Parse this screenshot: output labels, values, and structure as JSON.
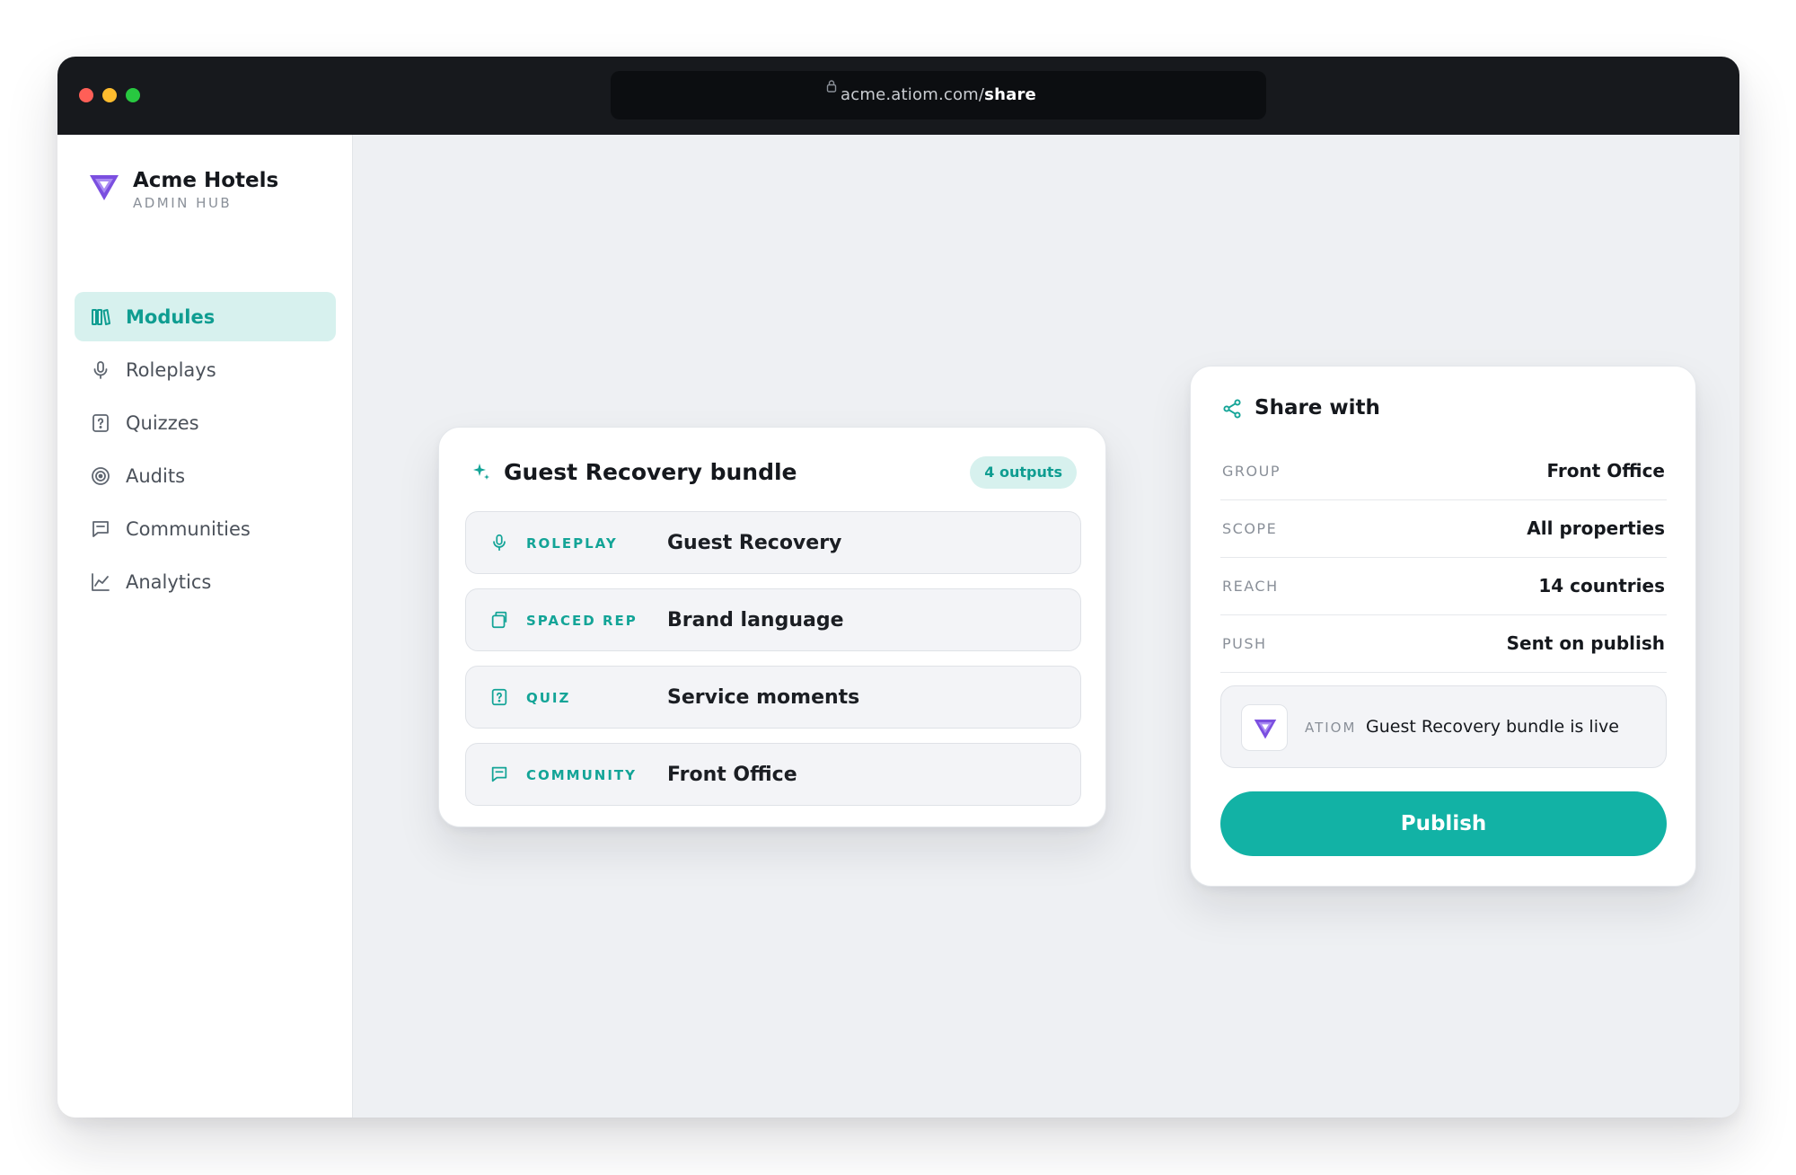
{
  "browser": {
    "url_host": "acme.atiom.com/",
    "url_path": "share"
  },
  "sidebar": {
    "brand_name": "Acme Hotels",
    "brand_sub": "ADMIN HUB",
    "items": [
      {
        "label": "Modules",
        "icon": "library-icon",
        "active": true
      },
      {
        "label": "Roleplays",
        "icon": "microphone-icon",
        "active": false
      },
      {
        "label": "Quizzes",
        "icon": "quiz-icon",
        "active": false
      },
      {
        "label": "Audits",
        "icon": "target-icon",
        "active": false
      },
      {
        "label": "Communities",
        "icon": "chat-icon",
        "active": false
      },
      {
        "label": "Analytics",
        "icon": "chart-icon",
        "active": false
      }
    ]
  },
  "bundle": {
    "title": "Guest Recovery bundle",
    "badge": "4 outputs",
    "outputs": [
      {
        "kind": "ROLEPLAY",
        "title": "Guest Recovery",
        "icon": "microphone-icon"
      },
      {
        "kind": "SPACED REP",
        "title": "Brand language",
        "icon": "cards-icon"
      },
      {
        "kind": "QUIZ",
        "title": "Service moments",
        "icon": "quiz-icon"
      },
      {
        "kind": "COMMUNITY",
        "title": "Front Office",
        "icon": "chat-icon"
      }
    ]
  },
  "share": {
    "title": "Share with",
    "rows": [
      {
        "key": "GROUP",
        "value": "Front Office"
      },
      {
        "key": "SCOPE",
        "value": "All properties"
      },
      {
        "key": "REACH",
        "value": "14 countries"
      },
      {
        "key": "PUSH",
        "value": "Sent on publish"
      }
    ],
    "notification": {
      "app": "ATIOM",
      "message": "Guest Recovery bundle is live"
    },
    "publish_label": "Publish"
  },
  "colors": {
    "accent": "#12b2a5",
    "accent_text": "#0f9d91",
    "accent_soft": "#d7f1ee",
    "brand_purple": "#7b4fe0",
    "titlebar": "#17191d"
  }
}
